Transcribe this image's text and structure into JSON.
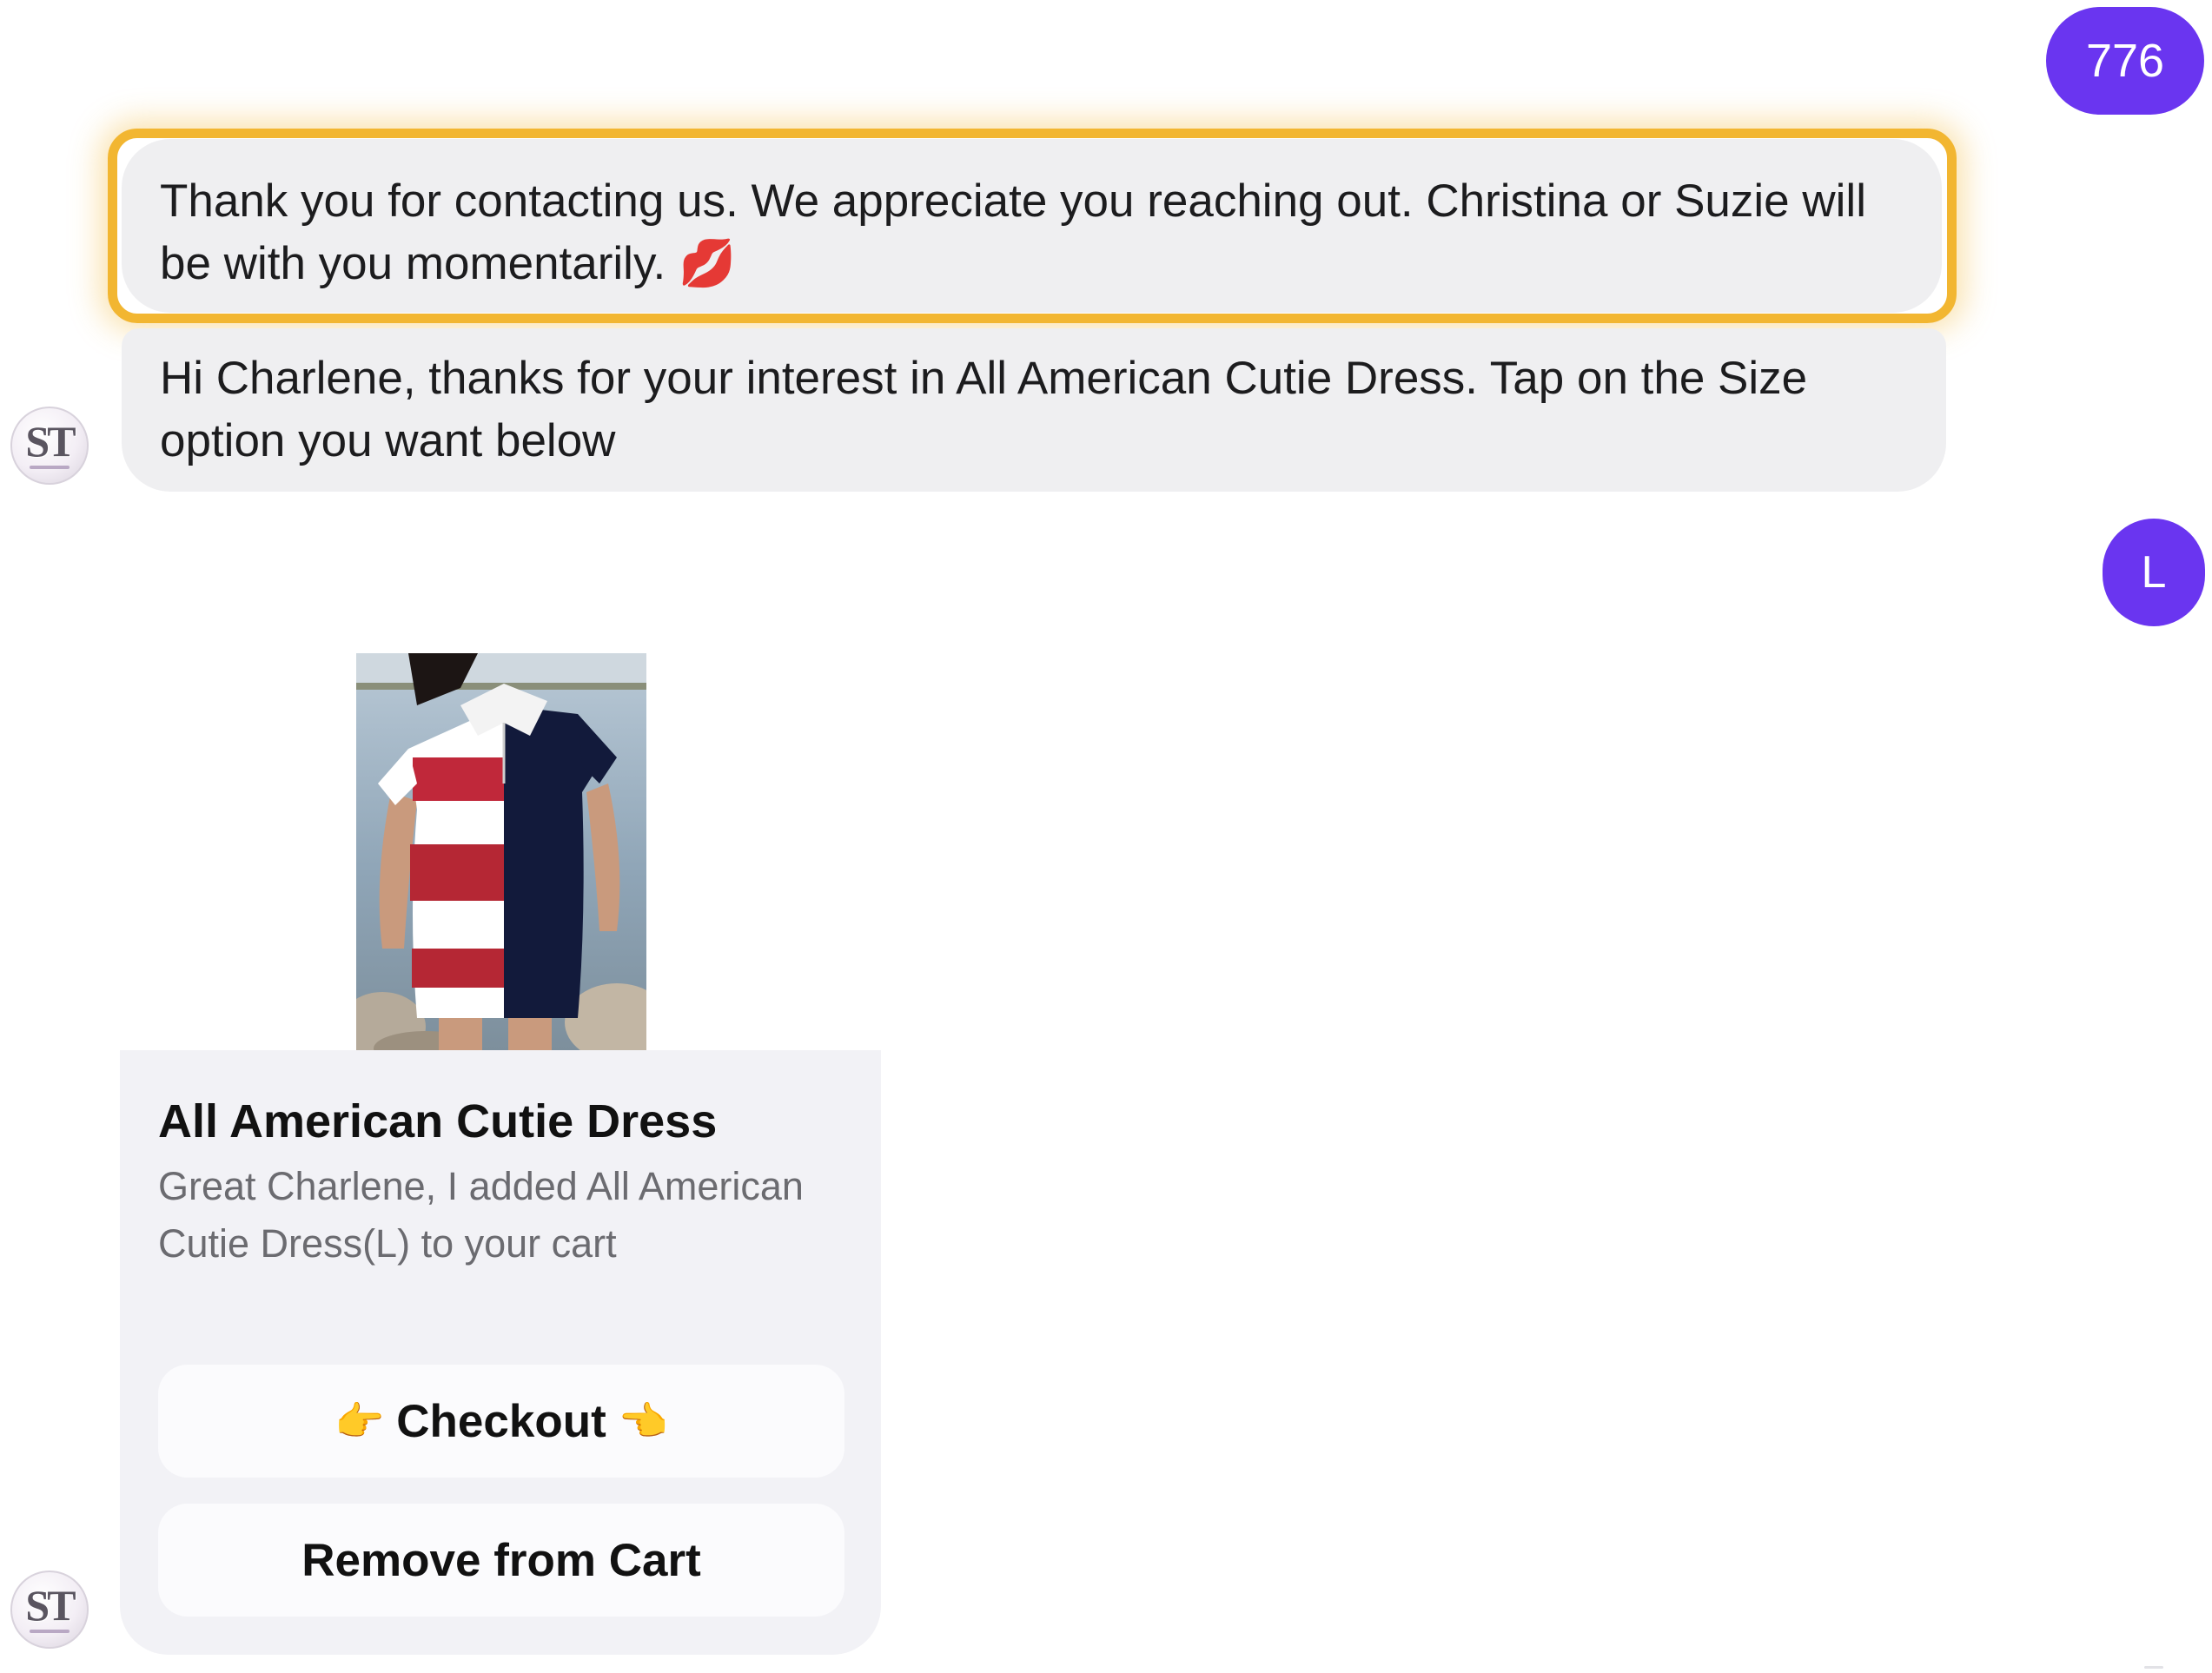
{
  "user_messages": [
    {
      "text": "776"
    },
    {
      "text": "L"
    }
  ],
  "incoming_messages": {
    "welcome": "Thank you for contacting us. We appreciate you reaching out. Christina or Suzie will be with you momentarily.",
    "welcome_emoji": "💋",
    "size_prompt": "Hi Charlene, thanks for your interest in All American Cutie Dress. Tap on the Size option you want below"
  },
  "avatar": {
    "monogram": "ST"
  },
  "product_card": {
    "title": "All American Cutie Dress",
    "description": "Great Charlene, I added All American Cutie Dress(L) to your cart",
    "checkout_label": "Checkout",
    "checkout_left_emoji": "👉",
    "checkout_right_emoji": "👈",
    "remove_label": "Remove from Cart"
  },
  "colors": {
    "user_bubble": "#6a35f0",
    "incoming_bubble": "#efeff1",
    "highlight_border": "#f2b631",
    "card_background": "#f2f2f6",
    "button_background": "#fbfbfd"
  }
}
